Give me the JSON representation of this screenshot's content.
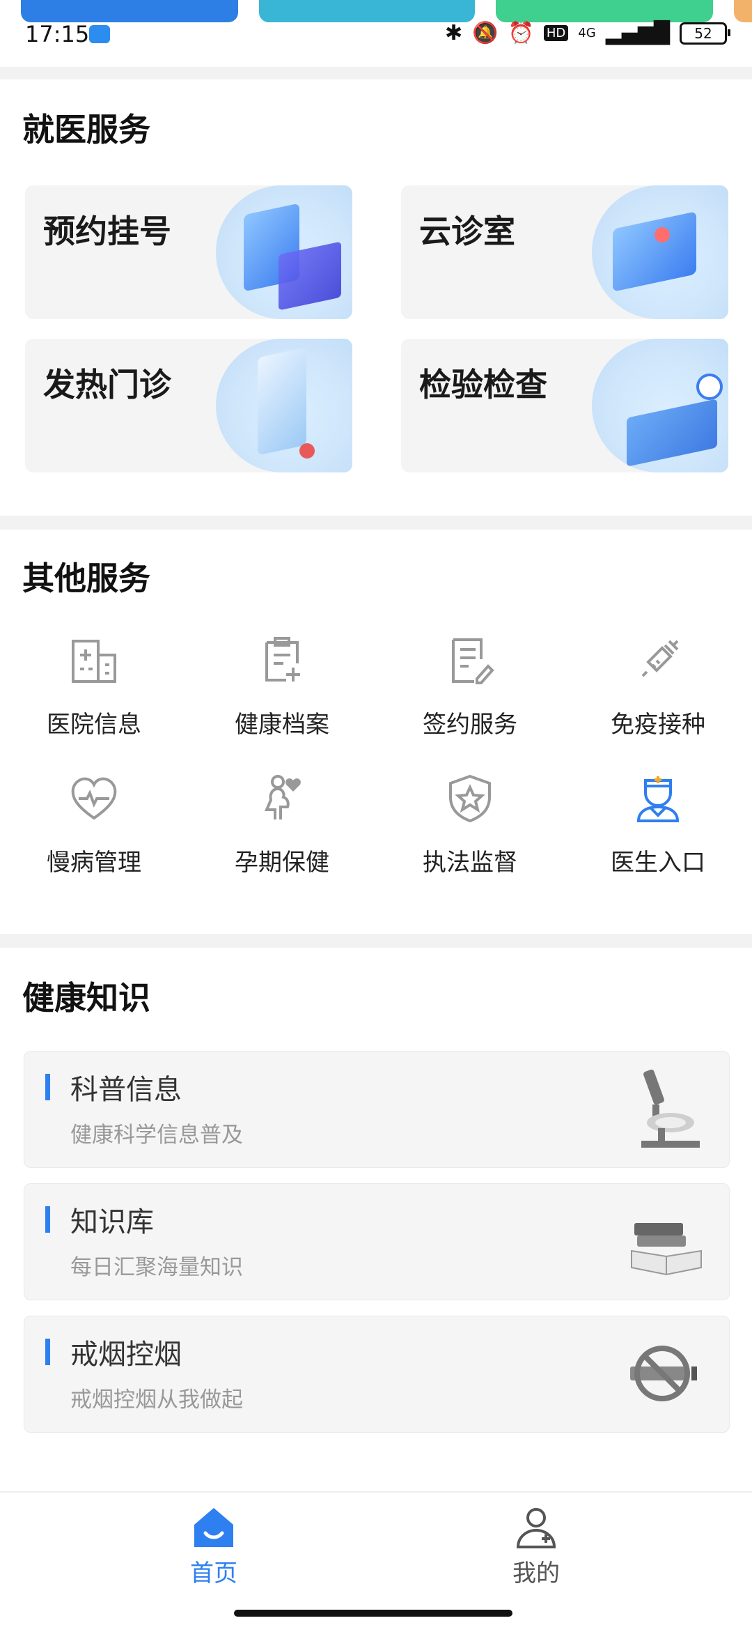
{
  "status_bar": {
    "time": "17:15",
    "battery": "52",
    "network": "4G"
  },
  "colors": {
    "accent": "#2e7ff0",
    "card_bg": "#f4f4f4",
    "gap": "#f2f2f2",
    "muted": "#999999"
  },
  "medical_services": {
    "title": "就医服务",
    "cards": [
      {
        "label": "预约挂号",
        "icon": "appointment-illustration"
      },
      {
        "label": "云诊室",
        "icon": "cloud-clinic-illustration"
      },
      {
        "label": "发热门诊",
        "icon": "fever-clinic-illustration"
      },
      {
        "label": "检验检查",
        "icon": "lab-test-illustration"
      }
    ]
  },
  "other_services": {
    "title": "其他服务",
    "items": [
      {
        "label": "医院信息",
        "icon": "hospital-icon"
      },
      {
        "label": "健康档案",
        "icon": "health-record-icon"
      },
      {
        "label": "签约服务",
        "icon": "contract-icon"
      },
      {
        "label": "免疫接种",
        "icon": "vaccine-icon"
      },
      {
        "label": "慢病管理",
        "icon": "heart-pulse-icon"
      },
      {
        "label": "孕期保健",
        "icon": "pregnancy-icon"
      },
      {
        "label": "执法监督",
        "icon": "shield-star-icon"
      },
      {
        "label": "医生入口",
        "icon": "doctor-icon"
      }
    ]
  },
  "health_knowledge": {
    "title": "健康知识",
    "cards": [
      {
        "title": "科普信息",
        "subtitle": "健康科学信息普及",
        "icon": "microscope-icon"
      },
      {
        "title": "知识库",
        "subtitle": "每日汇聚海量知识",
        "icon": "books-icon"
      },
      {
        "title": "戒烟控烟",
        "subtitle": "戒烟控烟从我做起",
        "icon": "no-smoking-icon"
      }
    ]
  },
  "tabbar": {
    "tabs": [
      {
        "label": "首页",
        "icon": "home-icon",
        "active": true
      },
      {
        "label": "我的",
        "icon": "user-icon",
        "active": false
      }
    ]
  }
}
